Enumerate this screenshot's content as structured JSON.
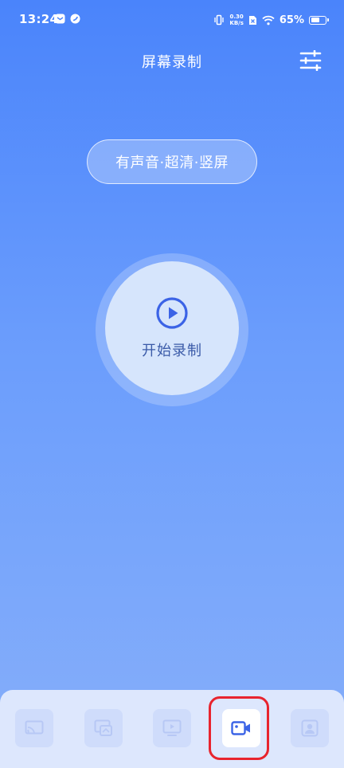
{
  "status_bar": {
    "time": "13:24",
    "net_speed_value": "0.30",
    "net_speed_unit": "KB/s",
    "battery_percent": "65%",
    "battery_level": 0.65
  },
  "header": {
    "title": "屏幕录制"
  },
  "mode": {
    "label": "有声音·超清·竖屏"
  },
  "record": {
    "label": "开始录制"
  },
  "bottom_nav": {
    "items": [
      {
        "icon": "screen-cast-icon",
        "active": false
      },
      {
        "icon": "screen-mirror-icon",
        "active": false
      },
      {
        "icon": "tv-icon",
        "active": false
      },
      {
        "icon": "video-camera-icon",
        "active": true
      },
      {
        "icon": "profile-icon",
        "active": false
      }
    ]
  },
  "colors": {
    "accent": "#3b63e6",
    "nav_icon_inactive": "#b7c8f5",
    "highlight": "#e8242e"
  }
}
